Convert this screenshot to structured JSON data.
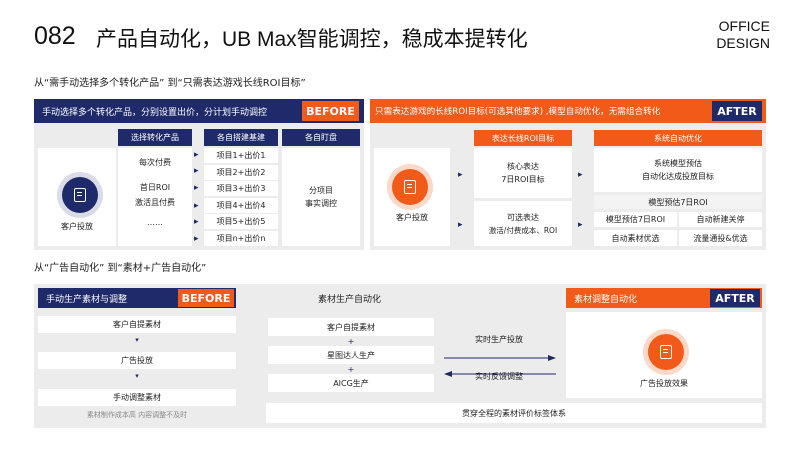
{
  "header": {
    "number": "082",
    "title": "产品自动化，UB Max智能调控，稳成本提转化",
    "brand_line1": "OFFICE",
    "brand_line2": "DESIGN"
  },
  "section1": {
    "heading": "从“需手动选择多个转化产品” 到“只需表达游戏长线ROI目标”",
    "before": {
      "title": "手动选择多个转化产品，分别设置出价，分计划手动调控",
      "badge": "BEFORE",
      "client_label": "客户投放",
      "col1_header": "选择转化产品",
      "col1_items": [
        "每次付费",
        "首日ROI",
        "激活且付费",
        "……"
      ],
      "col2_header": "各自搭建基建",
      "col2_items": [
        "项目1+出价1",
        "项目2+出价2",
        "项目3+出价3",
        "项目4+出价4",
        "项目5+出价5",
        "项目n+出价n"
      ],
      "col3_header": "各自盯盘",
      "col3_body_line1": "分项目",
      "col3_body_line2": "事实调控"
    },
    "after": {
      "title": "只需表达游戏的长线ROI目标(可选其他要求) ,模型自动优化，无需组合转化",
      "badge": "AFTER",
      "client_label": "客户投放",
      "mid_header": "表达长线ROI目标",
      "mid_box1_line1": "核心表达",
      "mid_box1_line2": "7日ROI目标",
      "mid_box2_line1": "可选表达",
      "mid_box2_line2": "激活/付费成本、ROI",
      "right_header": "系统自动优化",
      "right_top_line1": "系统模型预估",
      "right_top_line2": "自动化达成投放目标",
      "right_wide": "模型预估7日ROI",
      "grid": [
        "模型预估7日ROI",
        "自动新建关停",
        "自动素材优选",
        "流量通投&优选"
      ]
    }
  },
  "section2": {
    "heading": "从“广告自动化” 到“素材+广告自动化”",
    "before": {
      "title": "手动生产素材与调整",
      "badge": "BEFORE",
      "steps": [
        "客户自提素材",
        "广告投放",
        "手动调整素材"
      ],
      "note": "素材制作成本高  内容调整不及时"
    },
    "middle": {
      "title": "素材生产自动化",
      "steps": [
        "客户自提素材",
        "星图达人生产",
        "AICG生产"
      ],
      "arrow_right_label": "实时生产投放",
      "arrow_left_label": "实时反馈调整"
    },
    "after": {
      "title": "素材调整自动化",
      "badge": "AFTER",
      "client_label": "广告投放效果"
    },
    "bottom_bar": "贯穿全程的素材评价标签体系"
  },
  "colors": {
    "navy": "#1f2a6b",
    "orange": "#f25a1a"
  }
}
